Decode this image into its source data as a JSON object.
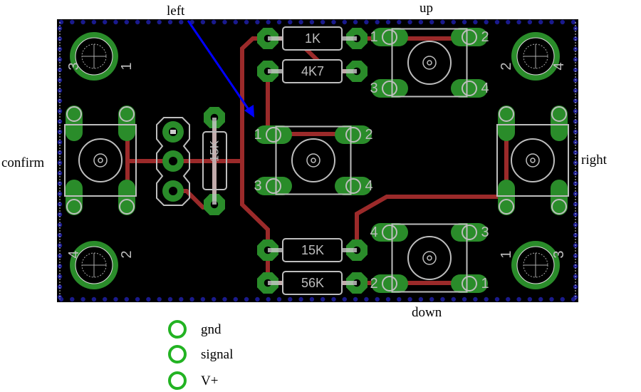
{
  "labels": {
    "left": "left",
    "up": "up",
    "right": "right",
    "confirm": "confirm",
    "down": "down"
  },
  "resistors": [
    {
      "id": "r1",
      "value": "1K"
    },
    {
      "id": "r2",
      "value": "4K7"
    },
    {
      "id": "r3",
      "value": "15K"
    },
    {
      "id": "r4",
      "value": "56K"
    },
    {
      "id": "r5",
      "value": "15K"
    }
  ],
  "switches": [
    {
      "id": "left",
      "pins": [
        "1",
        "2",
        "3",
        "4"
      ]
    },
    {
      "id": "up",
      "pins": [
        "1",
        "2",
        "3",
        "4"
      ]
    },
    {
      "id": "down",
      "pins": [
        "4",
        "3",
        "2",
        "1"
      ]
    },
    {
      "id": "confirm",
      "pins": [
        "3",
        "1",
        "4",
        "2"
      ]
    },
    {
      "id": "right",
      "pins": [
        "2",
        "4",
        "1",
        "3"
      ]
    }
  ],
  "legend": [
    {
      "label": "gnd"
    },
    {
      "label": "signal"
    },
    {
      "label": "V+"
    }
  ],
  "colors": {
    "board": "#000000",
    "pad": "#2a8c2a",
    "trace": "#9b2a2a",
    "silk": "#bdbdbd",
    "border_dots": "#1a1a8c",
    "arrow": "#0000ff"
  }
}
